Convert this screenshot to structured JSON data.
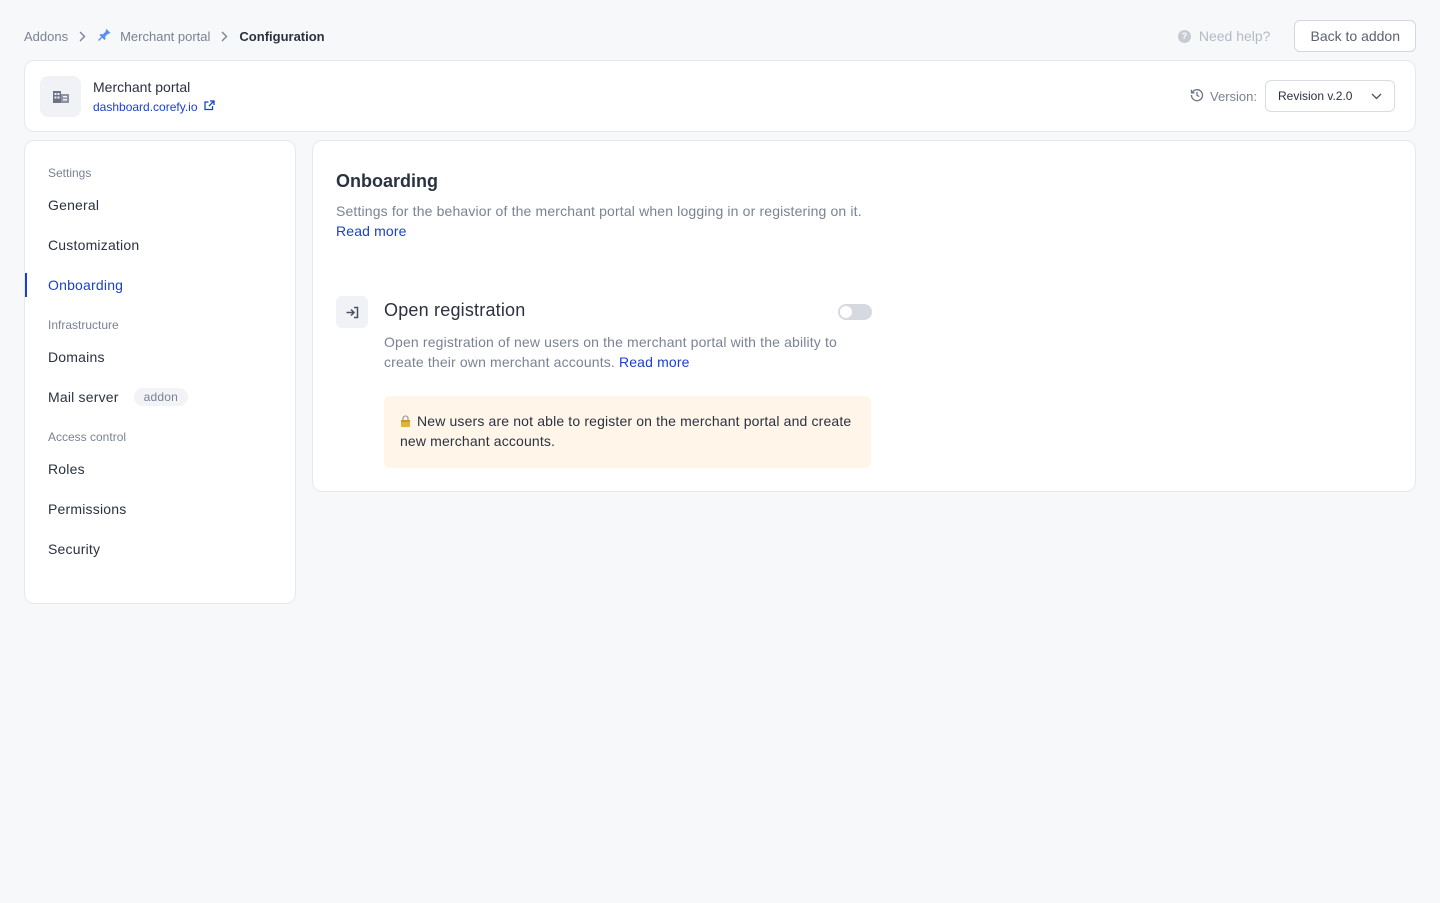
{
  "breadcrumb": {
    "items": [
      "Addons",
      "Merchant portal"
    ],
    "current": "Configuration"
  },
  "topbar": {
    "help_label": "Need help?",
    "back_label": "Back to addon"
  },
  "header": {
    "app_name": "Merchant portal",
    "app_link": "dashboard.corefy.io",
    "version_label": "Version:",
    "version_value": "Revision v.2.0"
  },
  "sidebar": {
    "groups": [
      {
        "label": "Settings",
        "items": [
          {
            "label": "General"
          },
          {
            "label": "Customization"
          },
          {
            "label": "Onboarding",
            "active": true
          }
        ]
      },
      {
        "label": "Infrastructure",
        "items": [
          {
            "label": "Domains"
          },
          {
            "label": "Mail server",
            "badge": "addon"
          }
        ]
      },
      {
        "label": "Access control",
        "items": [
          {
            "label": "Roles"
          },
          {
            "label": "Permissions"
          },
          {
            "label": "Security"
          }
        ]
      }
    ]
  },
  "main": {
    "title": "Onboarding",
    "description": "Settings for the behavior of the merchant portal when logging in or registering on it.",
    "read_more": "Read more",
    "feature": {
      "title": "Open registration",
      "enabled": false,
      "description": "Open registration of new users on the merchant portal with the ability to create their own merchant accounts.",
      "read_more": "Read more",
      "notice": "New users are not able to register on the merchant portal and create new merchant accounts."
    }
  },
  "colors": {
    "accent": "#1a3fd1",
    "notice_bg": "#fff6e9",
    "page_bg": "#f7f8fa"
  }
}
